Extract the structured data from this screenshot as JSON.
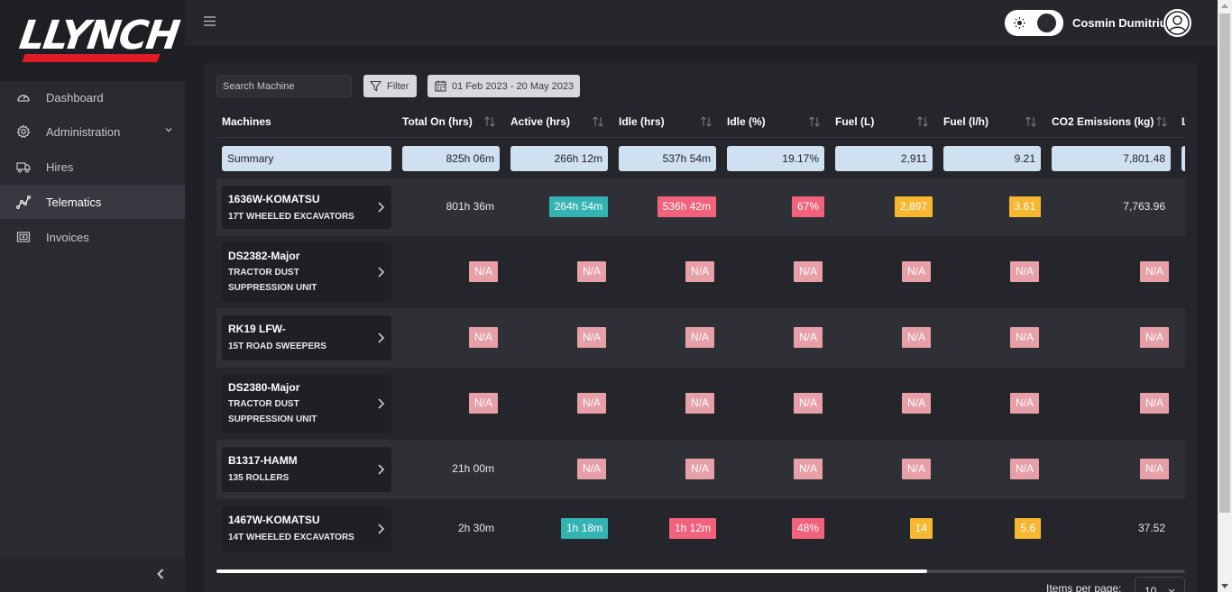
{
  "brand": {
    "logo_text": "LLYNCH"
  },
  "sidebar": {
    "items": [
      {
        "label": "Dashboard",
        "icon": "gauge-icon"
      },
      {
        "label": "Administration",
        "icon": "gear-icon"
      },
      {
        "label": "Hires",
        "icon": "truck-icon"
      },
      {
        "label": "Telematics",
        "icon": "graph-icon"
      },
      {
        "label": "Invoices",
        "icon": "invoice-icon"
      }
    ],
    "active": "Telematics"
  },
  "topbar": {
    "username": "Cosmin Dumitriu"
  },
  "toolbar": {
    "search_placeholder": "Search Machine",
    "filter_label": "Filter",
    "date_range": "01 Feb 2023 - 20 May 2023"
  },
  "table": {
    "columns": [
      "Machines",
      "Total On (hrs)",
      "Active (hrs)",
      "Idle (hrs)",
      "Idle (%)",
      "Fuel (L)",
      "Fuel (l/h)",
      "CO2 Emissions (kg)",
      "L"
    ],
    "summary": {
      "label": "Summary",
      "values": [
        "825h 06m",
        "266h 12m",
        "537h 54m",
        "19.17%",
        "2,911",
        "9.21",
        "7,801.48"
      ]
    },
    "rows": [
      {
        "name": "1636W-KOMATSU",
        "type": "17T WHEELED EXCAVATORS",
        "total_on": "801h 36m",
        "active": "264h 54m",
        "idle": "536h 42m",
        "idle_pct": "67%",
        "fuel": "2,897",
        "fuel_lh": "3.61",
        "co2": "7,763.96"
      },
      {
        "name": "DS2382-Major",
        "type": "TRACTOR DUST SUPPRESSION UNIT",
        "total_on": "N/A",
        "active": "N/A",
        "idle": "N/A",
        "idle_pct": "N/A",
        "fuel": "N/A",
        "fuel_lh": "N/A",
        "co2": "N/A"
      },
      {
        "name": "RK19 LFW-",
        "type": "15T ROAD SWEEPERS",
        "total_on": "N/A",
        "active": "N/A",
        "idle": "N/A",
        "idle_pct": "N/A",
        "fuel": "N/A",
        "fuel_lh": "N/A",
        "co2": "N/A"
      },
      {
        "name": "DS2380-Major",
        "type": "TRACTOR DUST SUPPRESSION UNIT",
        "total_on": "N/A",
        "active": "N/A",
        "idle": "N/A",
        "idle_pct": "N/A",
        "fuel": "N/A",
        "fuel_lh": "N/A",
        "co2": "N/A"
      },
      {
        "name": "B1317-HAMM",
        "type": "135 ROLLERS",
        "total_on": "21h 00m",
        "active": "N/A",
        "idle": "N/A",
        "idle_pct": "N/A",
        "fuel": "N/A",
        "fuel_lh": "N/A",
        "co2": "N/A"
      },
      {
        "name": "1467W-KOMATSU",
        "type": "14T WHEELED EXCAVATORS",
        "total_on": "2h 30m",
        "active": "1h 18m",
        "idle": "1h 12m",
        "idle_pct": "48%",
        "fuel": "14",
        "fuel_lh": "5.6",
        "co2": "37.52"
      }
    ]
  },
  "pagination": {
    "items_per_page_label": "Items per page:",
    "items_per_page": "10"
  },
  "colors": {
    "active_badge": "#34b3b3",
    "idle_badge": "#f2627d",
    "fuel_badge": "#f7b731",
    "na_badge": "#e8a0a8",
    "summary_bg": "#cfe0f1",
    "brand_red": "#e01b24"
  }
}
